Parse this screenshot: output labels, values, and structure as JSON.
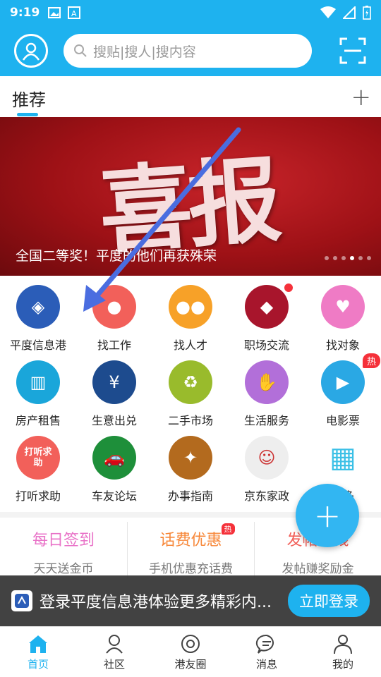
{
  "statusbar": {
    "time": "9:19"
  },
  "header": {
    "search_placeholder": "搜贴|搜人|搜内容"
  },
  "tabs": {
    "recommend": "推荐"
  },
  "banner": {
    "big_text": "喜报",
    "caption": "全国二等奖！平度的他们再获殊荣",
    "dots": 6,
    "active_dot": 3
  },
  "grid": [
    {
      "label": "平度信息港",
      "color": "#2b5db8",
      "glyph": "◈"
    },
    {
      "label": "找工作",
      "color": "#f2605a",
      "glyph": "●"
    },
    {
      "label": "找人才",
      "color": "#f7a128",
      "glyph": "●●"
    },
    {
      "label": "职场交流",
      "color": "#a8152c",
      "glyph": "◆"
    },
    {
      "label": "找对象",
      "color": "#ef7bc5",
      "glyph": "♥"
    },
    {
      "label": "房产租售",
      "color": "#1aa6da",
      "glyph": "▥"
    },
    {
      "label": "生意出兑",
      "color": "#1d4b8e",
      "glyph": "¥"
    },
    {
      "label": "二手市场",
      "color": "#99bb2c",
      "glyph": "♻"
    },
    {
      "label": "生活服务",
      "color": "#b26fd9",
      "glyph": "✋"
    },
    {
      "label": "电影票",
      "color": "#2aa8e4",
      "glyph": "▶"
    },
    {
      "label": "打听求助",
      "color": "#f2605a",
      "glyph": "打听求助"
    },
    {
      "label": "车友论坛",
      "color": "#1e8f3a",
      "glyph": "🚗"
    },
    {
      "label": "办事指南",
      "color": "#b36a1e",
      "glyph": "✦"
    },
    {
      "label": "京东家政",
      "color": "#eeeeee",
      "glyph": "☺"
    },
    {
      "label": "更多",
      "color": "#ffffff",
      "glyph": "▦"
    }
  ],
  "badges": {
    "hot": "热"
  },
  "promo": [
    {
      "title": "每日签到",
      "sub": "天天送金币",
      "color": "#e973c8"
    },
    {
      "title": "话费优惠",
      "sub": "手机优惠充话费",
      "color": "#f7883a"
    },
    {
      "title": "发帖赚钱",
      "sub": "发帖赚奖励金",
      "color": "#f2605a"
    }
  ],
  "login_bar": {
    "message": "登录平度信息港体验更多精彩内...",
    "button": "立即登录"
  },
  "bottom_nav": [
    {
      "label": "首页"
    },
    {
      "label": "社区"
    },
    {
      "label": "港友圈"
    },
    {
      "label": "消息"
    },
    {
      "label": "我的"
    }
  ],
  "colors": {
    "primary": "#1eb2ef",
    "hot": "#f5313a"
  }
}
